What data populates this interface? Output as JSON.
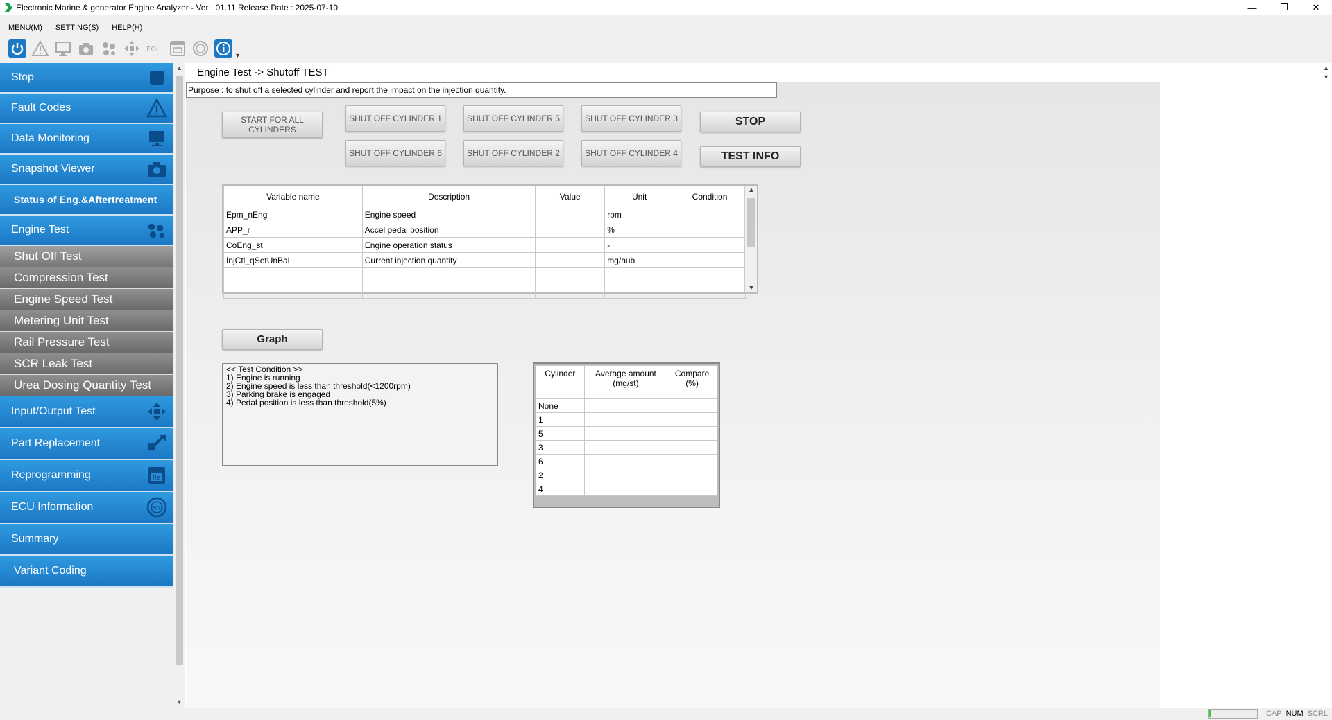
{
  "window": {
    "title": "Electronic Marine & generator Engine Analyzer - Ver : 01.11 Release Date : 2025-07-10",
    "minimize": "—",
    "restore": "❐",
    "close": "✕"
  },
  "menu": [
    "MENU(M)",
    "SETTING(S)",
    "HELP(H)"
  ],
  "toolbar": {
    "icons": [
      "power-icon",
      "warning-icon",
      "monitor-icon",
      "camera-icon",
      "engine-test-icon",
      "io-test-icon",
      "eol-icon",
      "reprogramming-icon",
      "ecu-icon",
      "info-icon"
    ],
    "eol_label": "EOL"
  },
  "sidebar": {
    "top_items": [
      {
        "label": "Stop",
        "icon": "stop-icon"
      },
      {
        "label": "Fault Codes",
        "icon": "warning-icon"
      },
      {
        "label": "Data Monitoring",
        "icon": "monitor-icon"
      },
      {
        "label": "Snapshot Viewer",
        "icon": "camera-icon"
      },
      {
        "label": "Status of Eng.&Aftertreatment",
        "icon": ""
      },
      {
        "label": "Engine Test",
        "icon": "engine-test-icon"
      }
    ],
    "sub_items": [
      "Shut Off Test",
      "Compression Test",
      "Engine Speed Test",
      "Metering Unit Test",
      "Rail Pressure Test",
      "SCR Leak Test",
      "Urea Dosing Quantity Test"
    ],
    "bottom_items": [
      {
        "label": "Input/Output Test",
        "icon": "io-test-icon"
      },
      {
        "label": "Part Replacement",
        "icon": "part-replacement-icon"
      },
      {
        "label": "Reprogramming",
        "icon": "reprogramming-icon"
      },
      {
        "label": "ECU Information",
        "icon": "ecu-icon"
      },
      {
        "label": "Summary",
        "icon": ""
      },
      {
        "label": "Variant Coding",
        "icon": ""
      }
    ],
    "ecu_icon_text": "ECU",
    "repro_icon_text": "Re"
  },
  "main": {
    "breadcrumb": "Engine Test -> Shutoff TEST",
    "purpose": "Purpose : to shut off a selected cylinder and report the impact on the injection quantity.",
    "buttons": {
      "start_all": "START FOR ALL CYLINDERS",
      "shut1": "SHUT OFF CYLINDER 1",
      "shut5": "SHUT OFF CYLINDER 5",
      "shut3": "SHUT OFF CYLINDER 3",
      "shut6": "SHUT OFF CYLINDER 6",
      "shut2": "SHUT OFF CYLINDER 2",
      "shut4": "SHUT OFF CYLINDER 4",
      "stop": "STOP",
      "test_info": "TEST INFO",
      "graph": "Graph"
    },
    "var_table": {
      "headers": [
        "Variable name",
        "Description",
        "Value",
        "Unit",
        "Condition"
      ],
      "rows": [
        [
          "Epm_nEng",
          "Engine speed",
          "",
          "rpm",
          ""
        ],
        [
          "APP_r",
          "Accel pedal position",
          "",
          "%",
          ""
        ],
        [
          "CoEng_st",
          "Engine operation status",
          "",
          "-",
          ""
        ],
        [
          "InjCtl_qSetUnBal",
          "Current injection quantity",
          "",
          "mg/hub",
          ""
        ],
        [
          "",
          "",
          "",
          "",
          ""
        ],
        [
          "",
          "",
          "",
          "",
          ""
        ]
      ]
    },
    "conditions": "<< Test Condition >>\n1) Engine is running\n2) Engine speed is less than threshold(<1200rpm)\n3) Parking brake is engaged\n4) Pedal position is less than threshold(5%)",
    "cyl_table": {
      "headers": [
        "Cylinder",
        "Average amount\n(mg/st)",
        "Compare\n(%)"
      ],
      "rows": [
        [
          "None",
          "",
          ""
        ],
        [
          "1",
          "",
          ""
        ],
        [
          "5",
          "",
          ""
        ],
        [
          "3",
          "",
          ""
        ],
        [
          "6",
          "",
          ""
        ],
        [
          "2",
          "",
          ""
        ],
        [
          "4",
          "",
          ""
        ]
      ]
    }
  },
  "statusbar": {
    "progress": 0.02,
    "cap": "CAP",
    "num": "NUM",
    "scrl": "SCRL"
  },
  "colors": {
    "sidebar_blue": "#1c78c4",
    "sidebar_gray": "#6a6a6a",
    "accent": "#2f9ae0"
  }
}
